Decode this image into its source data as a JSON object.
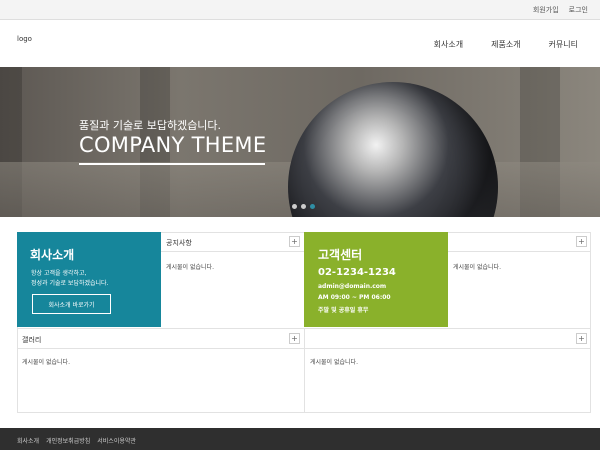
{
  "topbar": {
    "signup": "회원가입",
    "login": "로그인"
  },
  "header": {
    "logo": "logo",
    "nav": [
      "회사소개",
      "제품소개",
      "커뮤니티"
    ]
  },
  "hero": {
    "tagline": "품질과 기술로 보답하겠습니다.",
    "headline": "COMPANY THEME",
    "slide_count": 3,
    "active_slide": 3
  },
  "company": {
    "title": "회사소개",
    "desc_line1": "항상 고객을 생각하고,",
    "desc_line2": "정성과 기술로 보답하겠습니다.",
    "button": "회사소개 바로가기"
  },
  "notice": {
    "title": "공지사항",
    "plus": "+",
    "empty": "게시물이 없습니다."
  },
  "support": {
    "title": "고객센터",
    "phone": "02-1234-1234",
    "email": "admin@domain.com",
    "hours": "AM 09:00 ~ PM 06:00",
    "closed": "주말 및 공휴일 휴무"
  },
  "board_right": {
    "plus": "+",
    "empty": "게시물이 없습니다."
  },
  "gallery": {
    "title": "갤러리",
    "plus": "+",
    "empty": "게시물이 없습니다."
  },
  "board_bottom": {
    "plus": "+",
    "empty": "게시물이 없습니다."
  },
  "footer": {
    "links": [
      "회사소개",
      "개인정보취급방침",
      "서비스이용약관"
    ]
  },
  "colors": {
    "teal": "#16869b",
    "green": "#8ab12b",
    "footer": "#2f2f2f"
  }
}
